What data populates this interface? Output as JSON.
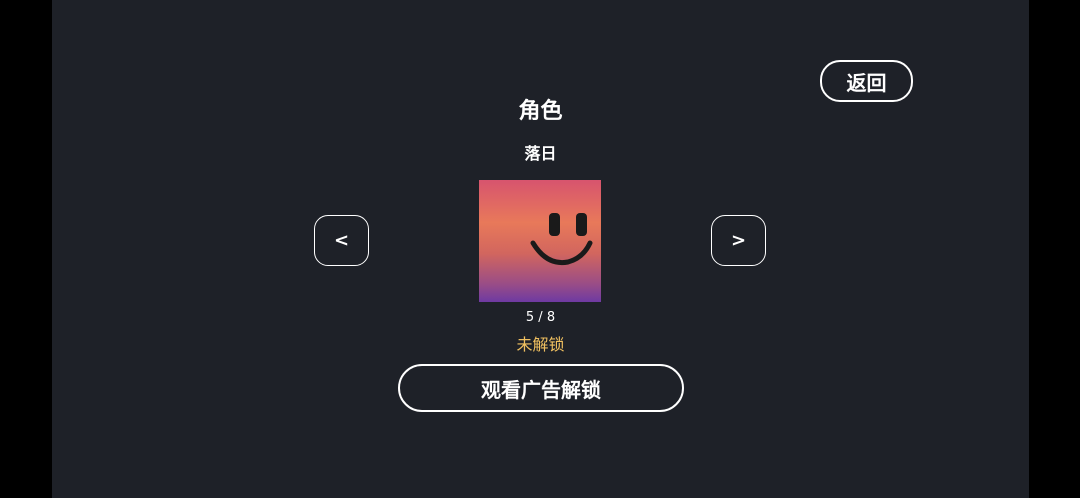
{
  "header": {
    "back_label": "返回",
    "title": "角色"
  },
  "character": {
    "name": "落日",
    "counter": "5 / 8",
    "status": "未解锁",
    "icon": "smiley-face-icon"
  },
  "navigation": {
    "prev_label": "<",
    "next_label": ">"
  },
  "actions": {
    "unlock_label": "观看广告解锁"
  },
  "colors": {
    "background": "#1e2128",
    "status": "#f0c060",
    "text": "#ffffff"
  }
}
